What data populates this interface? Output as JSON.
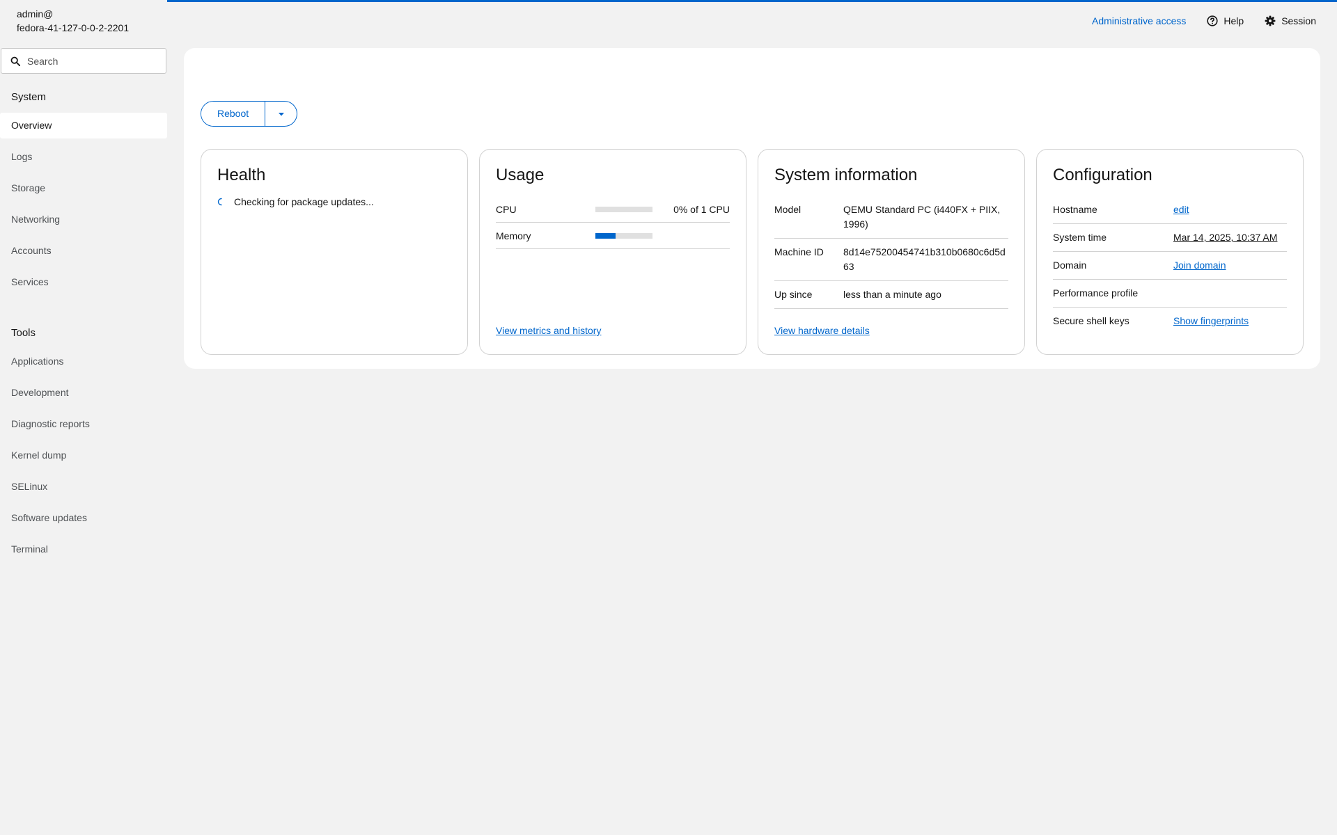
{
  "host": {
    "user": "admin@",
    "name": "fedora-41-127-0-0-2-2201"
  },
  "search": {
    "placeholder": "Search"
  },
  "nav": {
    "system_heading": "System",
    "system_items": [
      "Overview",
      "Logs",
      "Storage",
      "Networking",
      "Accounts",
      "Services"
    ],
    "tools_heading": "Tools",
    "tools_items": [
      "Applications",
      "Development",
      "Diagnostic reports",
      "Kernel dump",
      "SELinux",
      "Software updates",
      "Terminal"
    ]
  },
  "topbar": {
    "admin_access": "Administrative access",
    "help": "Help",
    "session": "Session"
  },
  "reboot": {
    "label": "Reboot"
  },
  "health": {
    "title": "Health",
    "status": "Checking for package updates..."
  },
  "usage": {
    "title": "Usage",
    "cpu_label": "CPU",
    "cpu_value": "0% of 1 CPU",
    "cpu_fraction": 0.0,
    "memory_label": "Memory",
    "memory_fraction": 0.35,
    "link": "View metrics and history"
  },
  "sysinfo": {
    "title": "System information",
    "model_label": "Model",
    "model_value": "QEMU Standard PC (i440FX + PIIX, 1996)",
    "machine_id_label": "Machine ID",
    "machine_id_value": "8d14e75200454741b310b0680c6d5d63",
    "up_since_label": "Up since",
    "up_since_value": "less than a minute ago",
    "link": "View hardware details"
  },
  "config": {
    "title": "Configuration",
    "hostname_label": "Hostname",
    "hostname_value": "edit",
    "time_label": "System time",
    "time_value": "Mar 14, 2025, 10:37 AM",
    "domain_label": "Domain",
    "domain_value": "Join domain",
    "perf_label": "Performance profile",
    "ssh_label": "Secure shell keys",
    "ssh_value": "Show fingerprints"
  },
  "colors": {
    "accent": "#0066cc",
    "background": "#f2f2f2"
  }
}
